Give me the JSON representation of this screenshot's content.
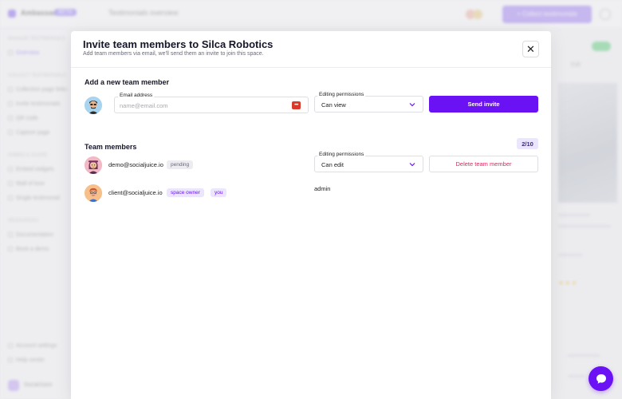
{
  "background": {
    "brand": "Ambassador",
    "badge": "BETA",
    "breadcrumb": "Testimonials overview",
    "cta_label": "+ Collect testimonials",
    "sidebar_sections": [
      "Manage testimonials",
      "Collect testimonials",
      "Embed & share",
      "Resources"
    ],
    "sidebar_items": [
      "Overview",
      "Collection page links",
      "Invite testimonials",
      "QR code",
      "Capture page",
      "Embed widgets",
      "Wall of love",
      "Single testimonial",
      "Documentation",
      "Book a demo",
      "Account settings",
      "Help center"
    ],
    "edit_label": "Edit",
    "user_name": "SocialJuice"
  },
  "modal": {
    "title": "Invite team members to Silca Robotics",
    "subtitle": "Add team members via email, we'll send them an invite to join this space.",
    "close_glyph": "✕",
    "add_section": {
      "title": "Add a new team member",
      "email_label": "Email address",
      "email_placeholder": "name@email.com",
      "email_value": "",
      "permissions_label": "Editing permissions",
      "permissions_value": "Can view",
      "send_label": "Send invite"
    },
    "members_section": {
      "title": "Team members",
      "count": "2/10",
      "members": [
        {
          "email": "demo@socialjuice.io",
          "tags": [
            "pending"
          ],
          "permissions_label": "Editing permissions",
          "permissions_value": "Can edit",
          "action_label": "Delete team member"
        },
        {
          "email": "client@socialjuice.io",
          "tags": [
            "space owner",
            "you"
          ],
          "role": "admin"
        }
      ]
    }
  },
  "icons": {
    "close": "close-icon",
    "chevron": "chevron-down-icon",
    "password_manager": "password-manager-icon",
    "chat": "chat-bubble-icon"
  },
  "colors": {
    "primary": "#6b12f5",
    "danger": "#e0245e",
    "tag_owner_bg": "#ebe5fd",
    "tag_pending_bg": "#ececf1"
  }
}
